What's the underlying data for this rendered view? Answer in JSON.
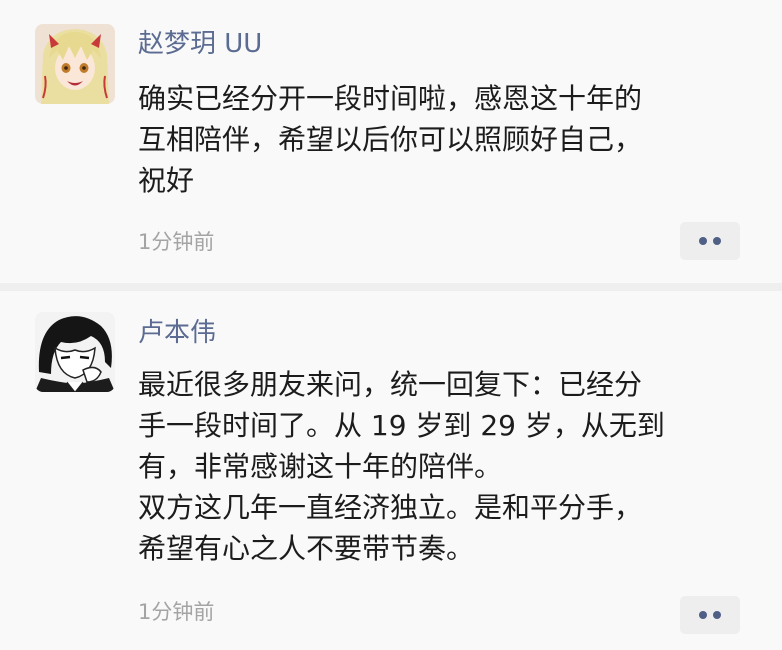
{
  "posts": [
    {
      "username": "赵梦玥 UU",
      "avatar": "anime-girl-avatar",
      "content_lines": [
        "确实已经分开一段时间啦，感恩这十年的",
        "互相陪伴，希望以后你可以照顾好自己，",
        "祝好"
      ],
      "time": "1分钟前",
      "more_icon": "more-dots-icon"
    },
    {
      "username": "卢本伟",
      "avatar": "anime-boy-avatar",
      "content_lines": [
        "最近很多朋友来问，统一回复下：已经分",
        "手一段时间了。从 19 岁到 29 岁，从无到",
        "有，非常感谢这十年的陪伴。",
        "双方这几年一直经济独立。是和平分手，",
        "希望有心之人不要带节奏。"
      ],
      "time": "1分钟前",
      "more_icon": "more-dots-icon"
    }
  ],
  "colors": {
    "username": "#5b6b91",
    "text": "#1c1c1c",
    "time": "#a4a4a4",
    "card_background": "#f9f9f9",
    "separator": "#efefef",
    "more_button_bg": "#eeeeee",
    "more_dots": "#4f5f86"
  }
}
